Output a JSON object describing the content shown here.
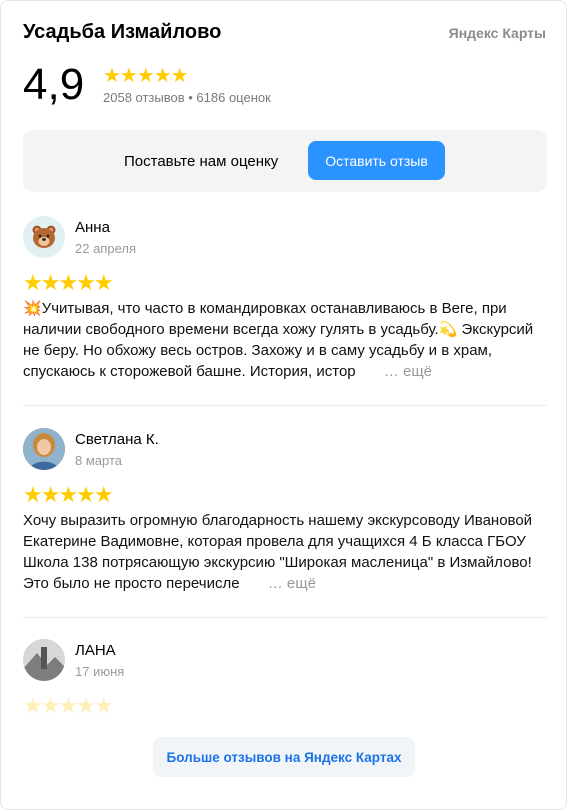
{
  "header": {
    "title": "Усадьба Измайлово",
    "brand": "Яндекс Карты"
  },
  "rating": {
    "value": "4,9",
    "stars": "★★★★★",
    "summary": "2058 отзывов • 6186 оценок"
  },
  "cta": {
    "prompt": "Поставьте нам оценку",
    "button_label": "Оставить отзыв"
  },
  "reviews": [
    {
      "author": "Анна",
      "date": "22 апреля",
      "stars": "★★★★★",
      "rating": 5,
      "text_prefix_icon": "💥",
      "text": "Учитывая, что часто в командировках останавливаюсь в Веге, при наличии свободного времени всегда хожу гулять в усадьбу.💫 Экскурсий не беру. Но обхожу весь остров. Захожу и в саму усадьбу и в храм, спускаюсь к сторожевой башне. История, истор",
      "more": "… ещё",
      "avatar_icon": "bear-emoji-avatar"
    },
    {
      "author": "Светлана К.",
      "date": "8 марта",
      "stars": "★★★★★",
      "rating": 5,
      "text": "Хочу выразить огромную благодарность нашему экскурсоводу Ивановой Екатерине Вадимовне, которая провела для учащихся 4 Б класса ГБОУ Школа 138 потрясающую экскурсию \"Широкая масленица\" в Измайлово! Это было не просто перечисле",
      "more": "… ещё",
      "avatar_icon": "photo-avatar"
    },
    {
      "author": "ЛАНА",
      "date": "17 июня",
      "stars": "★★★★★",
      "rating": 5,
      "avatar_icon": "photo-avatar"
    }
  ],
  "more_reviews_button": "Больше отзывов на Яндекс Картах",
  "colors": {
    "accent": "#2b93ff",
    "star": "#ffcc00",
    "link": "#1a73e8",
    "muted": "#9a9a9a"
  }
}
